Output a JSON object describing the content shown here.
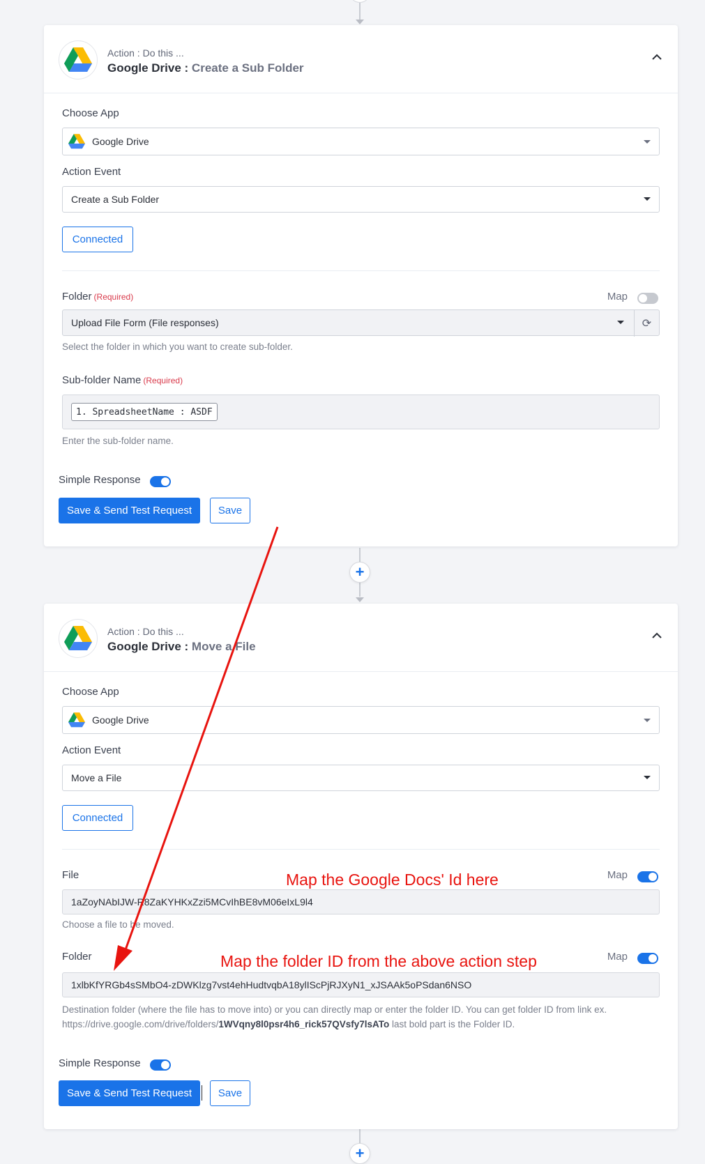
{
  "colors": {
    "accent": "#1a73e8",
    "annotation": "#e8140f",
    "required": "#d9394a"
  },
  "step1": {
    "subtitle": "Action : Do this ...",
    "app_name": "Google Drive",
    "separator": " : ",
    "event_name": "Create a Sub Folder",
    "choose_app_label": "Choose App",
    "choose_app_value": "Google Drive",
    "action_event_label": "Action Event",
    "action_event_value": "Create a Sub Folder",
    "connected_label": "Connected",
    "folder_label": "Folder",
    "required_text": "(Required)",
    "map_label": "Map",
    "folder_value": "Upload File Form (File responses)",
    "folder_help": "Select the folder in which you want to create sub-folder.",
    "subfolder_label": "Sub-folder Name",
    "subfolder_chip": "1. SpreadsheetName : ASDF",
    "subfolder_help": "Enter the sub-folder name.",
    "simple_response_label": "Simple Response",
    "save_send_label": "Save & Send Test Request",
    "save_label": "Save"
  },
  "step2": {
    "subtitle": "Action : Do this ...",
    "app_name": "Google Drive",
    "separator": " : ",
    "event_name": "Move a File",
    "choose_app_label": "Choose App",
    "choose_app_value": "Google Drive",
    "action_event_label": "Action Event",
    "action_event_value": "Move a File",
    "connected_label": "Connected",
    "file_label": "File",
    "map_label": "Map",
    "file_value": "1aZoyNAbIJW-R8ZaKYHKxZzi5MCvIhBE8vM06eIxL9l4",
    "file_help": "Choose a file to be moved.",
    "folder_label": "Folder",
    "folder_value": "1xlbKfYRGb4sSMbO4-zDWKlzg7vst4ehHudtvqbA18ylIScPjRJXyN1_xJSAAk5oPSdan6NSO",
    "folder_help_line1": "Destination folder (where the file has to move into) or you can directly map or enter the folder ID. You can get folder ID from link ex.",
    "folder_help_prefix": "https://drive.google.com/drive/folders/",
    "folder_help_bold": "1WVqny8l0psr4h6_rick57QVsfy7lsATo",
    "folder_help_suffix": " last bold part is the Folder ID.",
    "simple_response_label": "Simple Response",
    "save_send_label": "Save & Send Test Request",
    "save_label": "Save"
  },
  "annotations": {
    "file_note": "Map the Google Docs' Id here",
    "folder_note": "Map the folder ID from the above action step"
  },
  "icons": {
    "plus": "+",
    "refresh": "⟳"
  }
}
